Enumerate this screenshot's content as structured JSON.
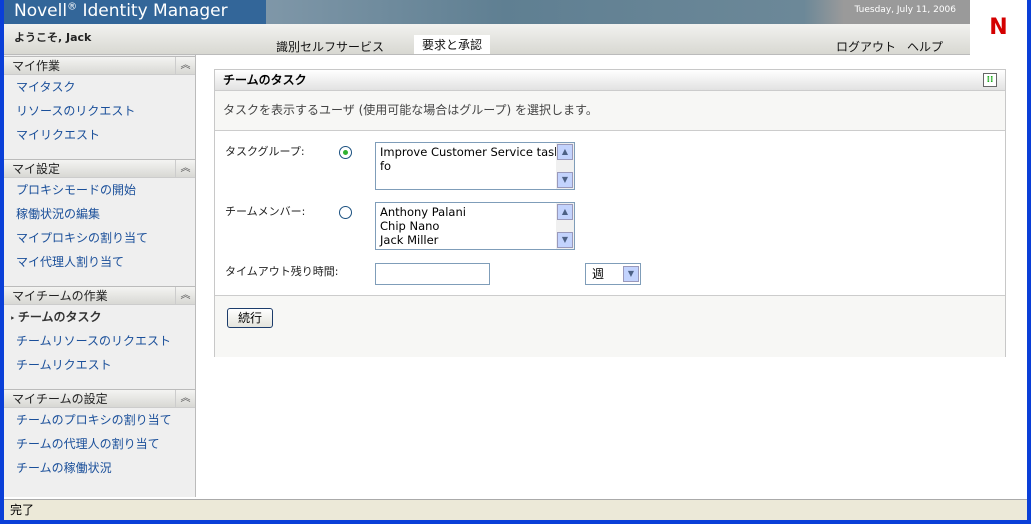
{
  "app": {
    "title": "Novell",
    "title_reg": "®",
    "title_rest": " Identity Manager",
    "date": "Tuesday, July 11, 2006",
    "logo": "N"
  },
  "nav": {
    "welcome": "ようこそ, Jack",
    "tabs": [
      {
        "label": "識別セルフサービス"
      },
      {
        "label": "要求と承認"
      }
    ],
    "logout": "ログアウト",
    "help": "ヘルプ"
  },
  "sidebar": [
    {
      "title": "マイ作業",
      "items": [
        "マイタスク",
        "リソースのリクエスト",
        "マイリクエスト"
      ]
    },
    {
      "title": "マイ設定",
      "items": [
        "プロキシモードの開始",
        "稼働状況の編集",
        "マイプロキシの割り当て",
        "マイ代理人割り当て"
      ]
    },
    {
      "title": "マイチームの作業",
      "items": [
        "チームのタスク",
        "チームリソースのリクエスト",
        "チームリクエスト"
      ]
    },
    {
      "title": "マイチームの設定",
      "items": [
        "チームのプロキシの割り当て",
        "チームの代理人の割り当て",
        "チームの稼働状況"
      ]
    }
  ],
  "panel": {
    "title": "チームのタスク",
    "description": "タスクを表示するユーザ (使用可能な場合はグループ) を選択します。",
    "task_group_label": "タスクグループ:",
    "task_groups": [
      "Improve Customer Service task fo"
    ],
    "team_member_label": "チームメンバー:",
    "team_members": [
      "Anthony Palani",
      "Chip Nano",
      "Jack Miller"
    ],
    "timeout_label": "タイムアウト残り時間:",
    "timeout_value": "",
    "unit": "週",
    "go": "続行"
  },
  "status": "完了"
}
